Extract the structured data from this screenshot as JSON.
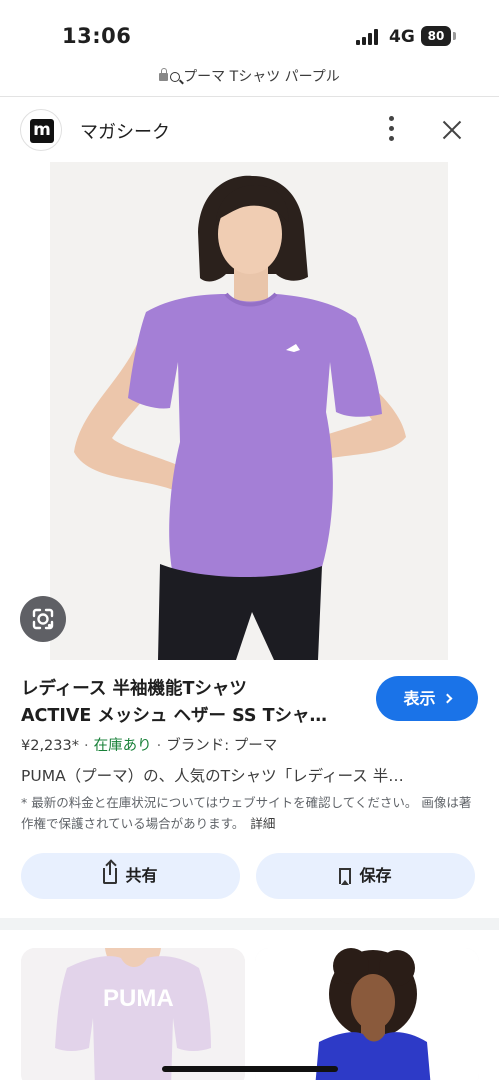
{
  "status_bar": {
    "time": "13:06",
    "network": "4G",
    "battery": "80"
  },
  "url_bar": {
    "query": "プーマ Tシャツ パープル"
  },
  "source": {
    "logo_letter": "m",
    "name": "マガシーク"
  },
  "product": {
    "title_line1": "レディース 半袖機能Tシャツ",
    "title_line2": "ACTIVE メッシュ ヘザー SS Tシャ…",
    "view_button": "表示",
    "price": "¥2,233*",
    "stock": "在庫あり",
    "brand": "ブランド: プーマ",
    "separator": "·",
    "description": "PUMA（プーマ）の、人気のTシャツ「レディース 半…",
    "disclaimer": "* 最新の料金と在庫状況についてはウェブサイトを確認してください。 画像は著作権で保護されている場合があります。",
    "details_link": "詳細"
  },
  "actions": {
    "share": "共有",
    "save": "保存"
  },
  "colors": {
    "accent": "#1a73e8",
    "shirt": "#a47fd6",
    "stock_green": "#188038",
    "action_bg": "#e8f0fe"
  },
  "icons": [
    "lock-icon",
    "search-icon",
    "more-vert-icon",
    "close-icon",
    "google-lens-icon",
    "chevron-right-icon",
    "share-icon",
    "bookmark-icon"
  ]
}
